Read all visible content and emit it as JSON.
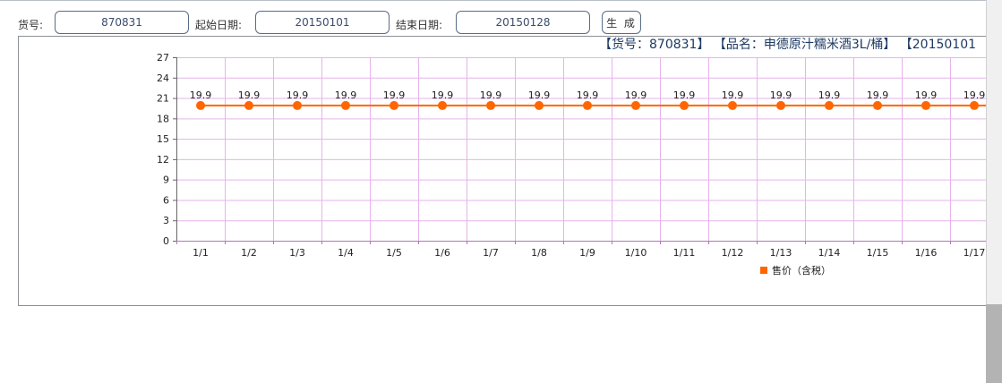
{
  "form": {
    "item_no_label": "货号:",
    "item_no_value": "870831",
    "start_date_label": "起始日期:",
    "start_date_value": "20150101",
    "end_date_label": "结束日期:",
    "end_date_value": "20150128",
    "generate_label": "生 成"
  },
  "chart_data": {
    "type": "line",
    "title": "【货号：870831】 【品名：申德原汁糯米酒3L/桶】 【20150101",
    "categories": [
      "1/1",
      "1/2",
      "1/3",
      "1/4",
      "1/5",
      "1/6",
      "1/7",
      "1/8",
      "1/9",
      "1/10",
      "1/11",
      "1/12",
      "1/13",
      "1/14",
      "1/15",
      "1/16",
      "1/17"
    ],
    "series": [
      {
        "name": "售价（含税）",
        "values": [
          19.9,
          19.9,
          19.9,
          19.9,
          19.9,
          19.9,
          19.9,
          19.9,
          19.9,
          19.9,
          19.9,
          19.9,
          19.9,
          19.9,
          19.9,
          19.9,
          19.9
        ],
        "color": "#ff6600"
      }
    ],
    "ylim": [
      0,
      27
    ],
    "yticks": [
      0,
      3,
      6,
      9,
      12,
      15,
      18,
      21,
      24,
      27
    ],
    "grid": true,
    "grid_color": "#e6b3ec",
    "legend_position": "bottom"
  }
}
